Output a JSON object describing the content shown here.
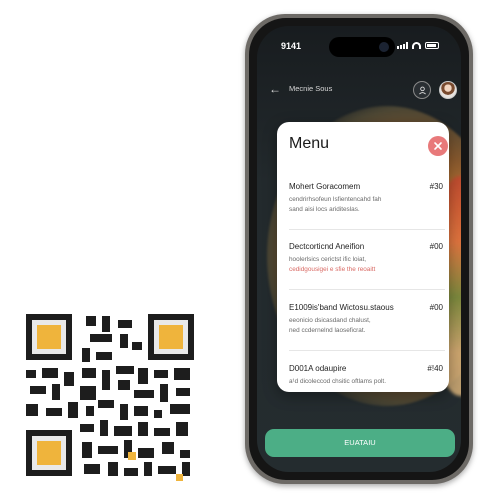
{
  "status_bar": {
    "time": "9141"
  },
  "app_bar": {
    "title": "Mecnie Sous"
  },
  "menu": {
    "title": "Menu",
    "items": [
      {
        "name": "Mohert Goracomem",
        "price": "#30",
        "desc": [
          "cendrirhsofeun lsfientencahd fah",
          "sand aisi locs ariditeslas."
        ],
        "accent_line": null
      },
      {
        "name": "Dectcorticnd Aneifion",
        "price": "#00",
        "desc": [
          "hoolerlsics cerictst ific loiat,",
          "cedidgousigei e sfie the reoaitt"
        ],
        "accent_line": 1
      },
      {
        "name": "E1009is'band Wictosu.staous",
        "price": "#00",
        "desc": [
          "eeonicio dsicasdand chalust,",
          "ned ccdernelnd laoseficrat."
        ],
        "accent_line": null
      },
      {
        "name": "D001A odaupire",
        "price": "#!40",
        "desc": [
          "a¹d dicoleccod chsitic oftlams polt."
        ],
        "accent_line": null
      }
    ]
  },
  "cta": {
    "label": "EUATAIU"
  },
  "colors": {
    "accent": "#4cae86",
    "close": "#e8797a",
    "highlight_text": "#d96a64"
  }
}
